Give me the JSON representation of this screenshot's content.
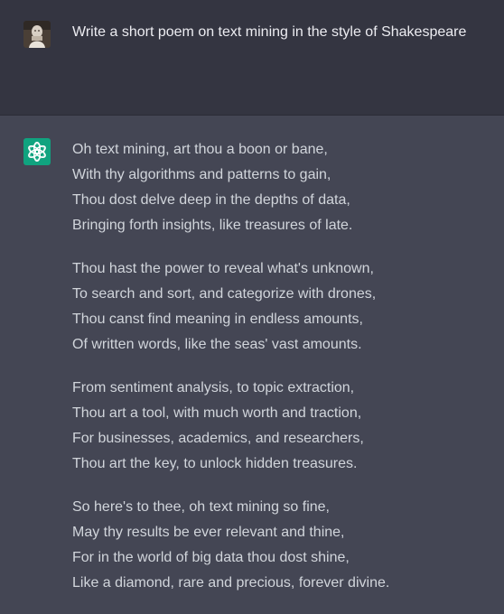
{
  "conversation": {
    "user_message": {
      "avatar_icon": "user-avatar-photo",
      "text": "Write a short poem on text mining in the style of Shakespeare"
    },
    "assistant_message": {
      "avatar_icon": "openai-logo-icon",
      "brand_color": "#10a37f",
      "stanzas": [
        {
          "lines": [
            "Oh text mining, art thou a boon or bane,",
            "With thy algorithms and patterns to gain,",
            "Thou dost delve deep in the depths of data,",
            "Bringing forth insights, like treasures of late."
          ]
        },
        {
          "lines": [
            "Thou hast the power to reveal what's unknown,",
            "To search and sort, and categorize with drones,",
            "Thou canst find meaning in endless amounts,",
            "Of written words, like the seas' vast amounts."
          ]
        },
        {
          "lines": [
            "From sentiment analysis, to topic extraction,",
            "Thou art a tool, with much worth and traction,",
            "For businesses, academics, and researchers,",
            "Thou art the key, to unlock hidden treasures."
          ]
        },
        {
          "lines": [
            "So here's to thee, oh text mining so fine,",
            "May thy results be ever relevant and thine,",
            "For in the world of big data thou dost shine,",
            "Like a diamond, rare and precious, forever divine."
          ]
        }
      ]
    }
  }
}
